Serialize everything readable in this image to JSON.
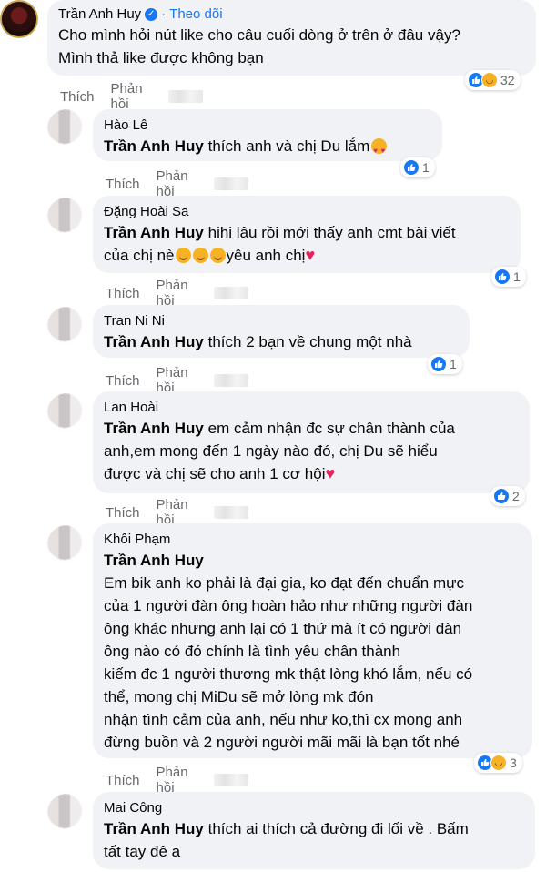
{
  "comments": [
    {
      "author": "Trần Anh Huy",
      "follow": "Theo dõi",
      "lines": [
        "Cho mình hỏi nút like cho câu cuối dòng ở trên ở đâu vậy?",
        "Mình thả like được không bạn"
      ],
      "like": "Thích",
      "reply": "Phản hồi",
      "reaction_count": "32"
    },
    {
      "author": "Hào Lê",
      "tag": "Trần Anh Huy",
      "lines": [
        " thích anh và chị Du lắm"
      ],
      "like": "Thích",
      "reply": "Phản hồi",
      "reaction_count": "1"
    },
    {
      "author": "Đặng Hoài Sa",
      "tag": "Trần Anh Huy",
      "lines": [
        " hihi lâu rồi mới thấy anh cmt bài viết",
        "của chị nè",
        "yêu anh chị"
      ],
      "like": "Thích",
      "reply": "Phản hồi",
      "reaction_count": "1"
    },
    {
      "author": "Tran Ni Ni",
      "tag": "Trần Anh Huy",
      "lines": [
        " thích 2 bạn về chung một nhà"
      ],
      "like": "Thích",
      "reply": "Phản hồi",
      "reaction_count": "1"
    },
    {
      "author": "Lan Hoài",
      "tag": "Trần Anh Huy",
      "lines": [
        " em cảm nhận đc sự chân thành của",
        "anh,em mong đến 1 ngày nào đó, chị Du sẽ hiểu",
        "được và chị sẽ cho anh 1 cơ hội"
      ],
      "like": "Thích",
      "reply": "Phản hồi",
      "reaction_count": "2"
    },
    {
      "author": "Khôi Phạm",
      "tag": "Trần Anh Huy",
      "lines": [
        "Em bik anh ko phải là đại gia, ko đạt đến chuẩn mực",
        "của 1 người đàn ông hoàn hảo như những người đàn",
        "ông khác nhưng anh lại có 1 thứ mà ít có người đàn",
        "ông nào có đó chính là tình yêu chân thành",
        "kiếm đc 1 người thương mk thật lòng khó lắm, nếu có",
        "thể, mong chị MiDu sẽ mở lòng mk đón",
        "nhận tình cảm của anh, nếu như ko,thì cx mong anh",
        "đừng buồn và 2 người người mãi mãi là bạn tốt nhé"
      ],
      "like": "Thích",
      "reply": "Phản hồi",
      "reaction_count": "3"
    },
    {
      "author": "Mai Công",
      "tag": "Trần Anh Huy",
      "lines": [
        " thích ai thích cả đường đi lối về . Bấm",
        "tất tay đê a"
      ]
    }
  ],
  "colors": {
    "accent": "#1877f2",
    "bubble": "#f0f2f5",
    "muted": "#65676b",
    "heart": "#e0245e"
  },
  "icons": [
    "verified-icon",
    "like-reaction-icon",
    "haha-reaction-icon",
    "heart-eyes-emoji",
    "smiling-emoji",
    "red-heart-emoji"
  ]
}
